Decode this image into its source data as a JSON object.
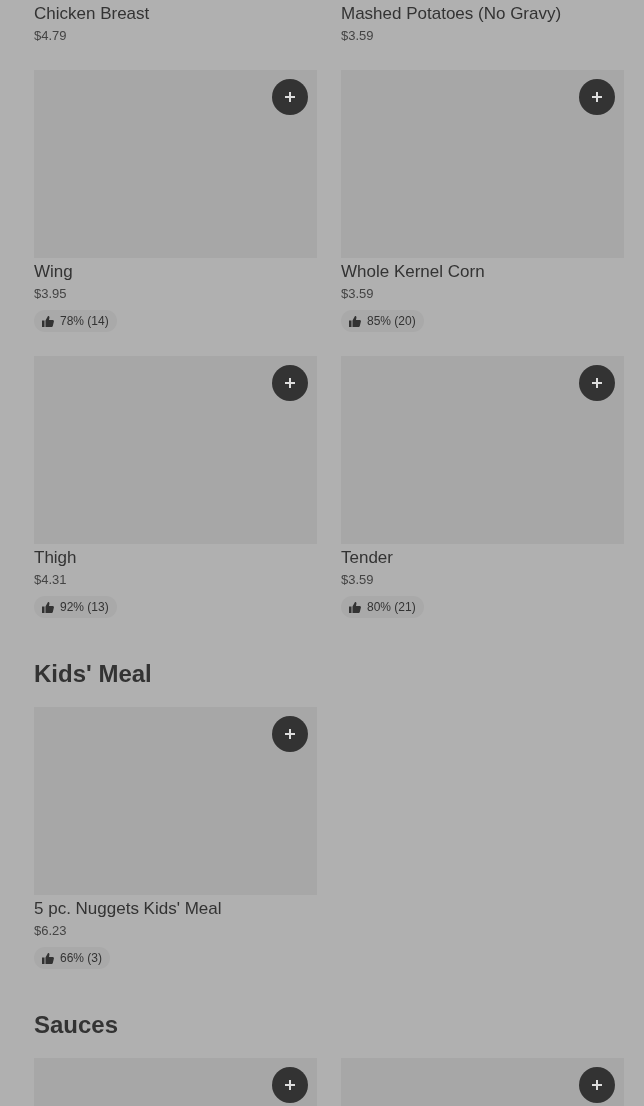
{
  "sections": [
    {
      "items": [
        {
          "name": "Chicken Breast",
          "price": "$4.79",
          "image": false
        },
        {
          "name": "Mashed Potatoes (No Gravy)",
          "price": "$3.59",
          "image": false
        },
        {
          "name": "Wing",
          "price": "$3.95",
          "image": true,
          "rating": "78% (14)"
        },
        {
          "name": "Whole Kernel Corn",
          "price": "$3.59",
          "image": true,
          "rating": "85% (20)"
        },
        {
          "name": "Thigh",
          "price": "$4.31",
          "image": true,
          "rating": "92% (13)"
        },
        {
          "name": "Tender",
          "price": "$3.59",
          "image": true,
          "rating": "80% (21)"
        }
      ]
    },
    {
      "heading": "Kids' Meal",
      "items": [
        {
          "name": "5 pc. Nuggets Kids' Meal",
          "price": "$6.23",
          "image": true,
          "rating": "66% (3)"
        }
      ]
    },
    {
      "heading": "Sauces",
      "items": [
        {
          "image": true
        },
        {
          "image": true
        }
      ]
    }
  ]
}
